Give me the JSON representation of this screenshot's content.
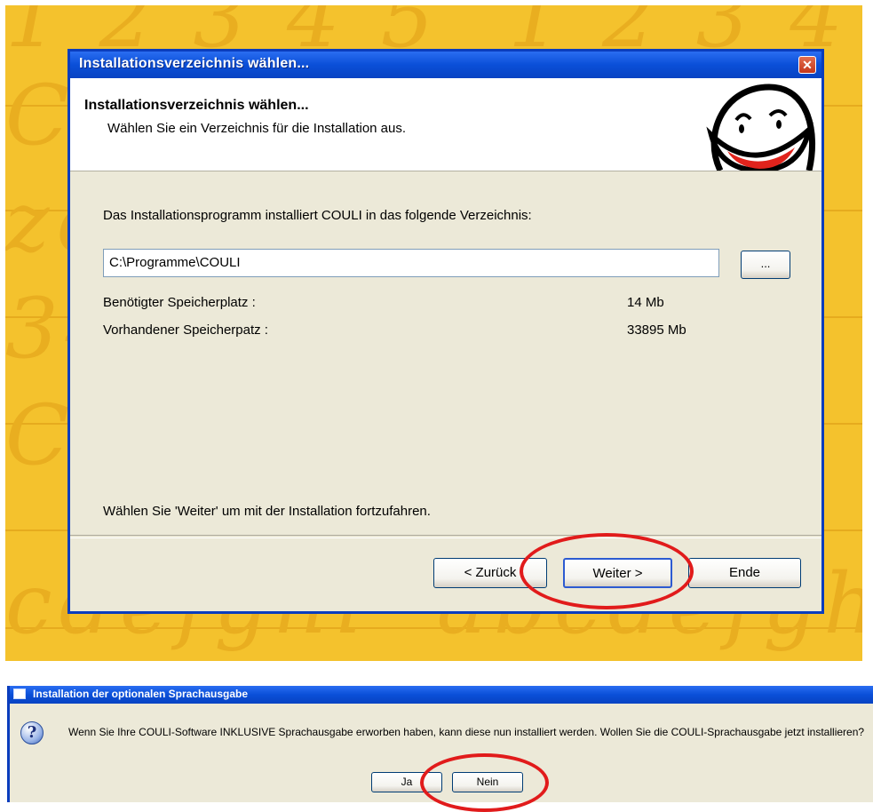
{
  "installer": {
    "title": "Installationsverzeichnis wählen...",
    "close_glyph": "✕",
    "header": {
      "heading": "Installationsverzeichnis wählen...",
      "subheading": "Wählen Sie ein Verzeichnis für die Installation aus."
    },
    "mascot_icon": "smiley-face-icon",
    "intro": "Das Installationsprogramm installiert COULI in das folgende Verzeichnis:",
    "path_value": "C:\\Programme\\COULI",
    "browse_label": "...",
    "required_space": {
      "label": "Benötigter Speicherplatz :",
      "value": "14 Mb"
    },
    "available_space": {
      "label": "Vorhandener Speicherpatz :",
      "value": "33895 Mb"
    },
    "continue_hint": "Wählen Sie 'Weiter' um mit der Installation fortzufahren.",
    "buttons": {
      "back": "< Zurück",
      "next": "Weiter >",
      "end": "Ende"
    }
  },
  "language_prompt": {
    "title": "Installation der optionalen Sprachausgabe",
    "icon": "question-icon",
    "message": "Wenn Sie Ihre COULI-Software INKLUSIVE Sprachausgabe erworben haben, kann diese nun installiert werden. Wollen Sie die COULI-Sprachausgabe jetzt installieren?",
    "buttons": {
      "yes": "Ja",
      "no": "Nein"
    }
  },
  "colors": {
    "highlight_ring": "#e11b1b",
    "backdrop": "#f4c22d",
    "xp_title_blue": "#0a4fd8"
  }
}
